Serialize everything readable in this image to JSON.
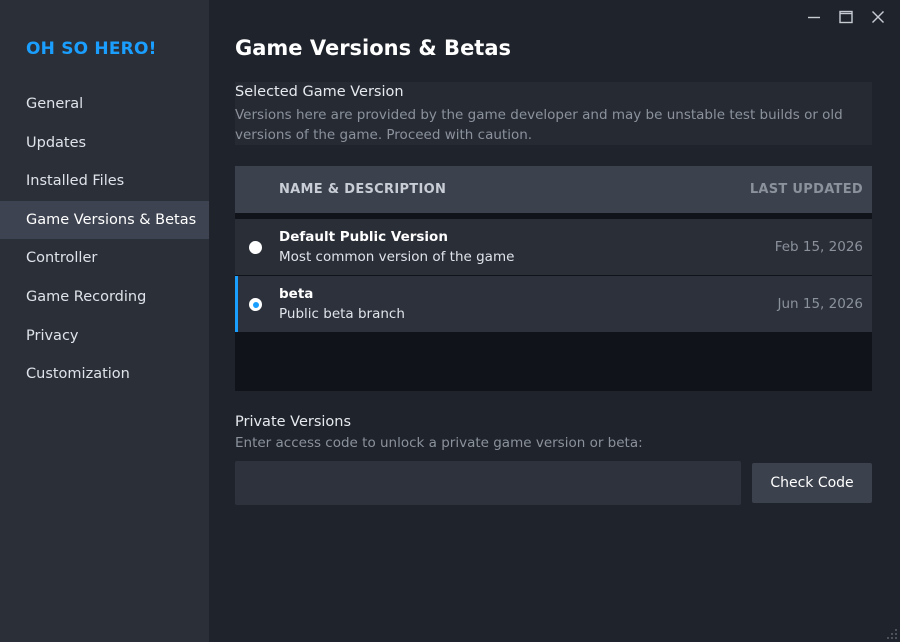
{
  "sidebar": {
    "game_title": "OH SO HERO!",
    "items": [
      {
        "label": "General"
      },
      {
        "label": "Updates"
      },
      {
        "label": "Installed Files"
      },
      {
        "label": "Game Versions & Betas",
        "active": true
      },
      {
        "label": "Controller"
      },
      {
        "label": "Game Recording"
      },
      {
        "label": "Privacy"
      },
      {
        "label": "Customization"
      }
    ]
  },
  "window_controls": {
    "minimize_icon": "minimize-icon",
    "maximize_icon": "maximize-icon",
    "close_icon": "close-icon"
  },
  "main": {
    "title": "Game Versions & Betas",
    "selected_section": {
      "label": "Selected Game Version",
      "description": "Versions here are provided by the game developer and may be unstable test builds or old versions of the game. Proceed with caution."
    },
    "table": {
      "headers": {
        "name": "NAME & DESCRIPTION",
        "date": "LAST UPDATED"
      },
      "rows": [
        {
          "name": "Default Public Version",
          "description": "Most common version of the game",
          "date": "Feb 15, 2026",
          "selected": false
        },
        {
          "name": "beta",
          "description": "Public beta branch",
          "date": "Jun 15, 2026",
          "selected": true
        }
      ]
    },
    "private_section": {
      "label": "Private Versions",
      "description": "Enter access code to unlock a private game version or beta:",
      "input_value": "",
      "input_placeholder": "",
      "button_label": "Check Code"
    }
  },
  "colors": {
    "accent": "#1a9fff",
    "sidebar_bg": "#2b2f38",
    "active_item_bg": "#3d4350",
    "main_bg": "#1f232b"
  }
}
